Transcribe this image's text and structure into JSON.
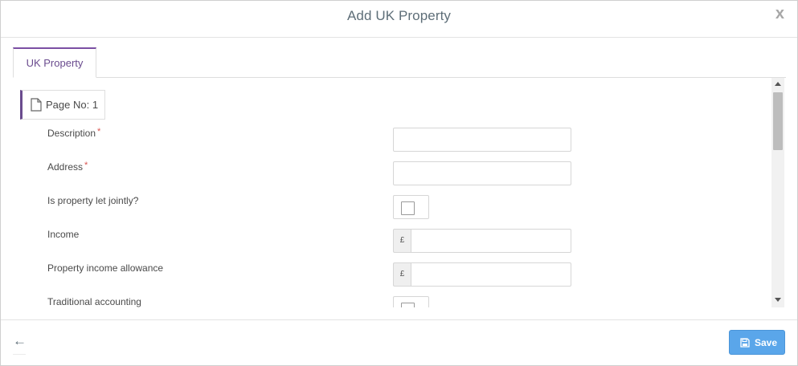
{
  "dialog": {
    "title": "Add UK Property",
    "close_glyph": "x"
  },
  "tabs": [
    {
      "label": "UK Property",
      "active": true
    }
  ],
  "page_badge": {
    "label": "Page No: 1",
    "icon": "document-icon"
  },
  "form": {
    "description": {
      "label": "Description",
      "required_mark": "*",
      "value": ""
    },
    "address": {
      "label": "Address",
      "required_mark": "*",
      "value": ""
    },
    "let_jointly": {
      "label": "Is property let jointly?",
      "checked": false
    },
    "income": {
      "label": "Income",
      "currency": "£",
      "value": ""
    },
    "allowance": {
      "label": "Property income allowance",
      "currency": "£",
      "value": ""
    },
    "traditional_accounting": {
      "label": "Traditional accounting",
      "checked": false
    }
  },
  "footer": {
    "back_glyph": "←",
    "save_label": "Save"
  },
  "colors": {
    "accent_purple": "#6a4b8e",
    "save_blue": "#5aa6ea",
    "required_red": "#d9534f"
  }
}
